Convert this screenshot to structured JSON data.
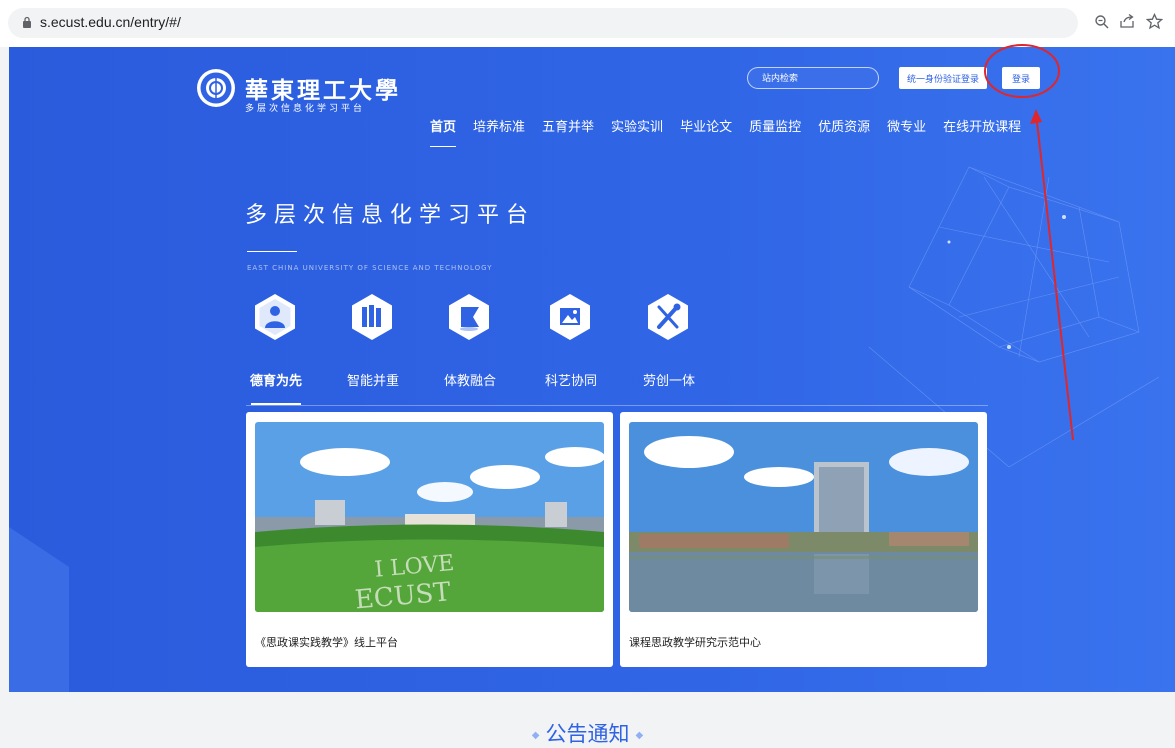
{
  "browser": {
    "url": "s.ecust.edu.cn/entry/#/",
    "icons": [
      "lock-icon",
      "zoom-icon",
      "share-icon",
      "bookmark-star-icon"
    ]
  },
  "header": {
    "school_name": "華東理工大學",
    "platform_subtitle": "多层次信息化学习平台",
    "search_placeholder": "站内检索",
    "sso_label": "统一身份验证登录",
    "login_label": "登录"
  },
  "nav": {
    "items": [
      {
        "label": "首页",
        "active": true
      },
      {
        "label": "培养标准"
      },
      {
        "label": "五育并举"
      },
      {
        "label": "实验实训"
      },
      {
        "label": "毕业论文"
      },
      {
        "label": "质量监控"
      },
      {
        "label": "优质资源"
      },
      {
        "label": "微专业"
      },
      {
        "label": "在线开放课程"
      }
    ]
  },
  "hero": {
    "title": "多层次信息化学习平台",
    "subtitle_en": "EAST CHINA UNIVERSITY OF SCIENCE AND TECHNOLOGY"
  },
  "tabs": {
    "items": [
      {
        "label": "德育为先",
        "icon": "person-icon",
        "active": true
      },
      {
        "label": "智能并重",
        "icon": "books-icon"
      },
      {
        "label": "体教融合",
        "icon": "flag-icon"
      },
      {
        "label": "科艺协同",
        "icon": "picture-icon"
      },
      {
        "label": "劳创一体",
        "icon": "tools-icon"
      }
    ]
  },
  "cards": [
    {
      "label": "《思政课实践教学》线上平台"
    },
    {
      "label": "课程思政教学研究示范中心"
    }
  ],
  "notice": {
    "title": "公告通知"
  },
  "colors": {
    "primary": "#2f63e4",
    "annotation": "#e0262b"
  }
}
